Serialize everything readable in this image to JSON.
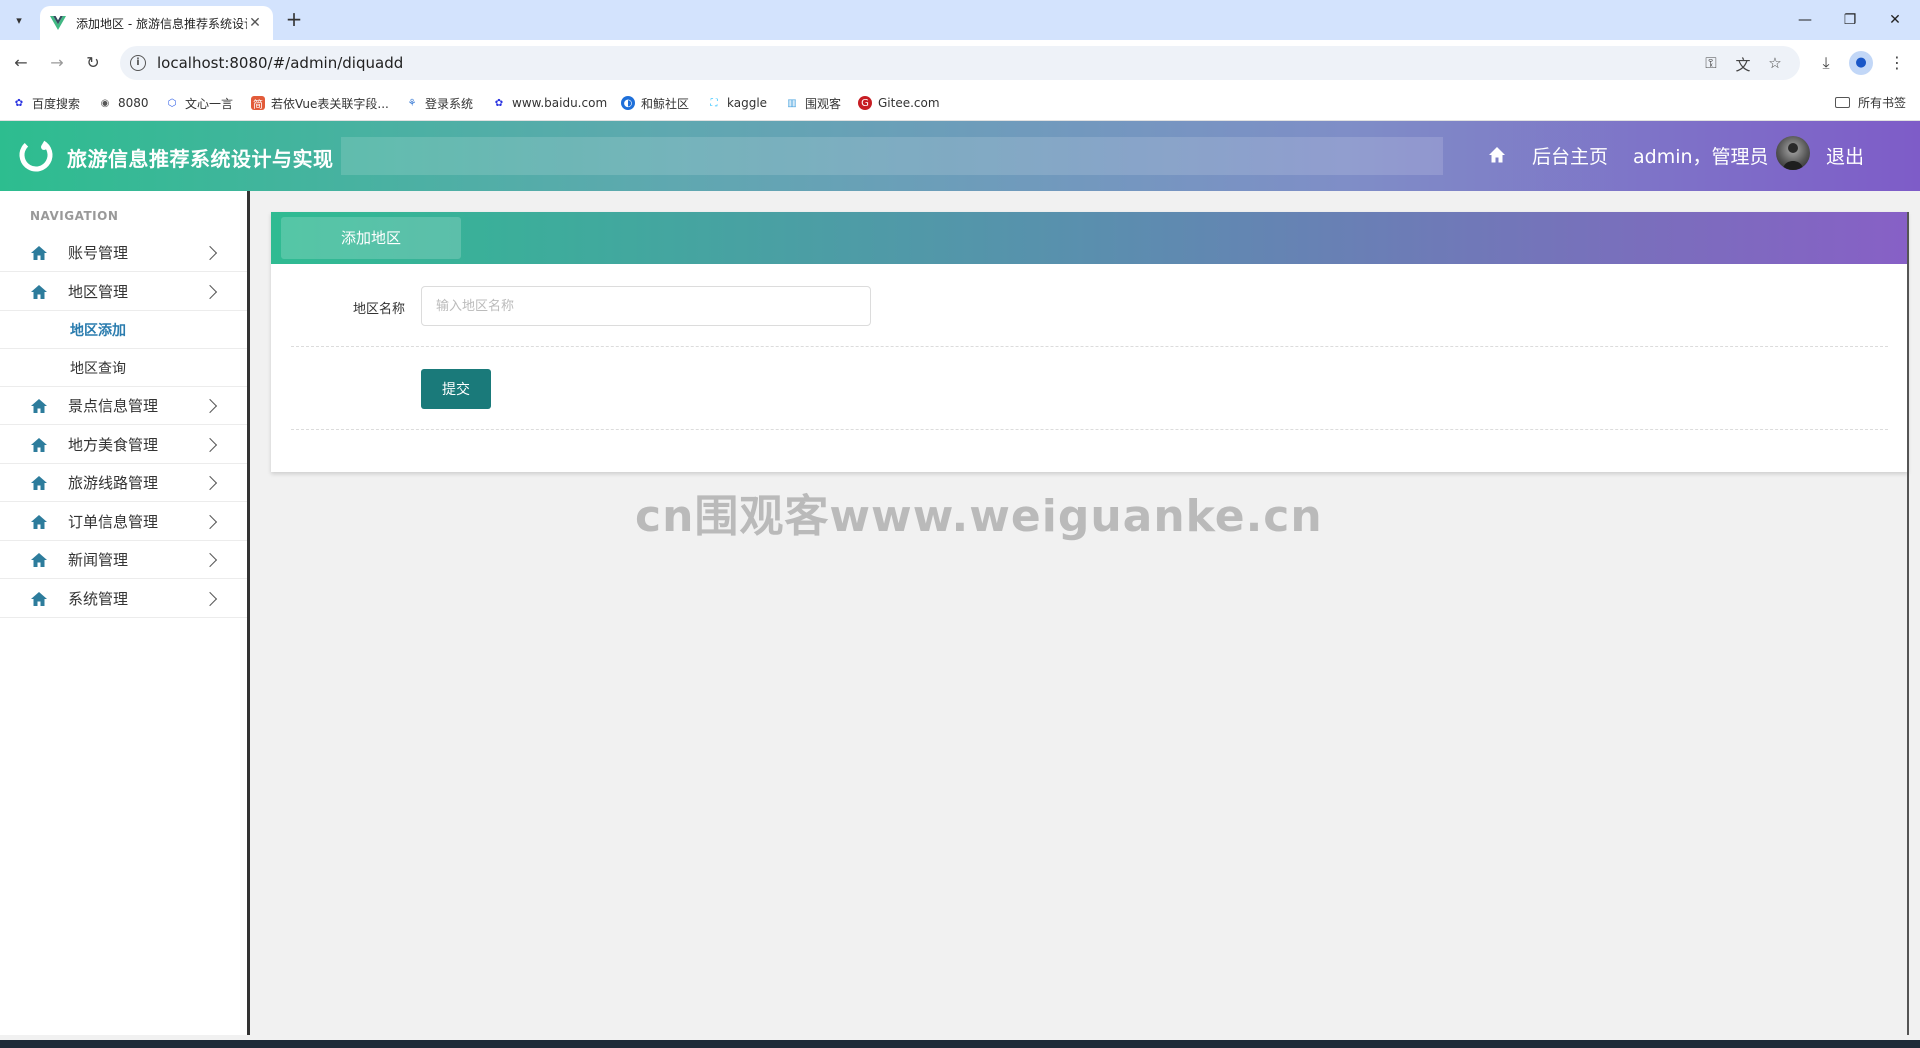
{
  "browser": {
    "tab_title": "添加地区 - 旅游信息推荐系统设计与实现",
    "url": "localhost:8080/#/admin/diquadd",
    "bookmarks": [
      {
        "label": "百度搜索",
        "icon": "baidu-paw"
      },
      {
        "label": "8080",
        "icon": "globe"
      },
      {
        "label": "文心一言",
        "icon": "wenxin"
      },
      {
        "label": "若依Vue表关联字段...",
        "icon": "jian"
      },
      {
        "label": "登录系统",
        "icon": "lotus"
      },
      {
        "label": "www.baidu.com",
        "icon": "baidu-paw"
      },
      {
        "label": "和鲸社区",
        "icon": "heywhale"
      },
      {
        "label": "kaggle",
        "icon": "kaggle"
      },
      {
        "label": "围观客",
        "icon": "weiguanke"
      },
      {
        "label": "Gitee.com",
        "icon": "gitee"
      }
    ],
    "all_bookmarks": "所有书签"
  },
  "header": {
    "title": "旅游信息推荐系统设计与实现",
    "home_link": "后台主页",
    "user": "admin，管理员",
    "logout": "退出"
  },
  "sidebar": {
    "heading": "NAVIGATION",
    "items": [
      {
        "label": "账号管理"
      },
      {
        "label": "地区管理"
      },
      {
        "label": "景点信息管理"
      },
      {
        "label": "地方美食管理"
      },
      {
        "label": "旅游线路管理"
      },
      {
        "label": "订单信息管理"
      },
      {
        "label": "新闻管理"
      },
      {
        "label": "系统管理"
      }
    ],
    "sub_items": [
      {
        "label": "地区添加",
        "active": true
      },
      {
        "label": "地区查询",
        "active": false
      }
    ]
  },
  "main": {
    "card_title": "添加地区",
    "field_label": "地区名称",
    "field_placeholder": "输入地区名称",
    "field_value": "",
    "submit_label": "提交"
  },
  "watermark": "cn围观客www.weiguanke.cn",
  "colors": {
    "accent": "#1a7a7a",
    "active_sub": "#2a7cae",
    "header_start": "#2dbd8f",
    "header_end": "#7e5cc8"
  }
}
